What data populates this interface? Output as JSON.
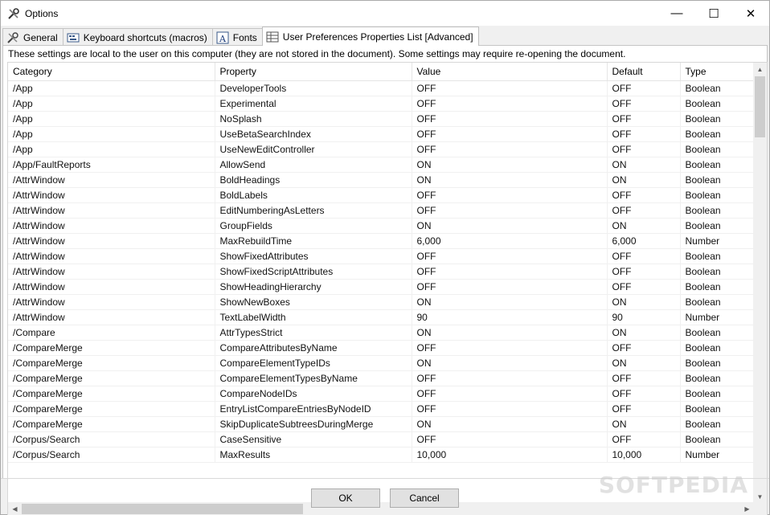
{
  "window": {
    "title": "Options",
    "minimize": "—",
    "maximize": "☐",
    "close": "✕"
  },
  "tabs": [
    {
      "label": "General",
      "icon": "wrench-icon"
    },
    {
      "label": "Keyboard shortcuts (macros)",
      "icon": "keyboard-icon"
    },
    {
      "label": "Fonts",
      "icon": "font-icon"
    },
    {
      "label": "User Preferences Properties List [Advanced]",
      "icon": "properties-list-icon",
      "active": true
    }
  ],
  "notice": "These settings are local to the user on this computer (they are not stored in the document). Some settings may require re-opening the document.",
  "table": {
    "columns": [
      "Category",
      "Property",
      "Value",
      "Default",
      "Type"
    ],
    "rows": [
      [
        "/App",
        "DeveloperTools",
        "OFF",
        "OFF",
        "Boolean"
      ],
      [
        "/App",
        "Experimental",
        "OFF",
        "OFF",
        "Boolean"
      ],
      [
        "/App",
        "NoSplash",
        "OFF",
        "OFF",
        "Boolean"
      ],
      [
        "/App",
        "UseBetaSearchIndex",
        "OFF",
        "OFF",
        "Boolean"
      ],
      [
        "/App",
        "UseNewEditController",
        "OFF",
        "OFF",
        "Boolean"
      ],
      [
        "/App/FaultReports",
        "AllowSend",
        "ON",
        "ON",
        "Boolean"
      ],
      [
        "/AttrWindow",
        "BoldHeadings",
        "ON",
        "ON",
        "Boolean"
      ],
      [
        "/AttrWindow",
        "BoldLabels",
        "OFF",
        "OFF",
        "Boolean"
      ],
      [
        "/AttrWindow",
        "EditNumberingAsLetters",
        "OFF",
        "OFF",
        "Boolean"
      ],
      [
        "/AttrWindow",
        "GroupFields",
        "ON",
        "ON",
        "Boolean"
      ],
      [
        "/AttrWindow",
        "MaxRebuildTime",
        "6,000",
        "6,000",
        "Number"
      ],
      [
        "/AttrWindow",
        "ShowFixedAttributes",
        "OFF",
        "OFF",
        "Boolean"
      ],
      [
        "/AttrWindow",
        "ShowFixedScriptAttributes",
        "OFF",
        "OFF",
        "Boolean"
      ],
      [
        "/AttrWindow",
        "ShowHeadingHierarchy",
        "OFF",
        "OFF",
        "Boolean"
      ],
      [
        "/AttrWindow",
        "ShowNewBoxes",
        "ON",
        "ON",
        "Boolean"
      ],
      [
        "/AttrWindow",
        "TextLabelWidth",
        "90",
        "90",
        "Number"
      ],
      [
        "/Compare",
        "AttrTypesStrict",
        "ON",
        "ON",
        "Boolean"
      ],
      [
        "/CompareMerge",
        "CompareAttributesByName",
        "OFF",
        "OFF",
        "Boolean"
      ],
      [
        "/CompareMerge",
        "CompareElementTypeIDs",
        "ON",
        "ON",
        "Boolean"
      ],
      [
        "/CompareMerge",
        "CompareElementTypesByName",
        "OFF",
        "OFF",
        "Boolean"
      ],
      [
        "/CompareMerge",
        "CompareNodeIDs",
        "OFF",
        "OFF",
        "Boolean"
      ],
      [
        "/CompareMerge",
        "EntryListCompareEntriesByNodeID",
        "OFF",
        "OFF",
        "Boolean"
      ],
      [
        "/CompareMerge",
        "SkipDuplicateSubtreesDuringMerge",
        "ON",
        "ON",
        "Boolean"
      ],
      [
        "/Corpus/Search",
        "CaseSensitive",
        "OFF",
        "OFF",
        "Boolean"
      ],
      [
        "/Corpus/Search",
        "MaxResults",
        "10,000",
        "10,000",
        "Number"
      ]
    ]
  },
  "buttons": {
    "ok": "OK",
    "cancel": "Cancel"
  },
  "watermark": "SOFTPEDIA"
}
